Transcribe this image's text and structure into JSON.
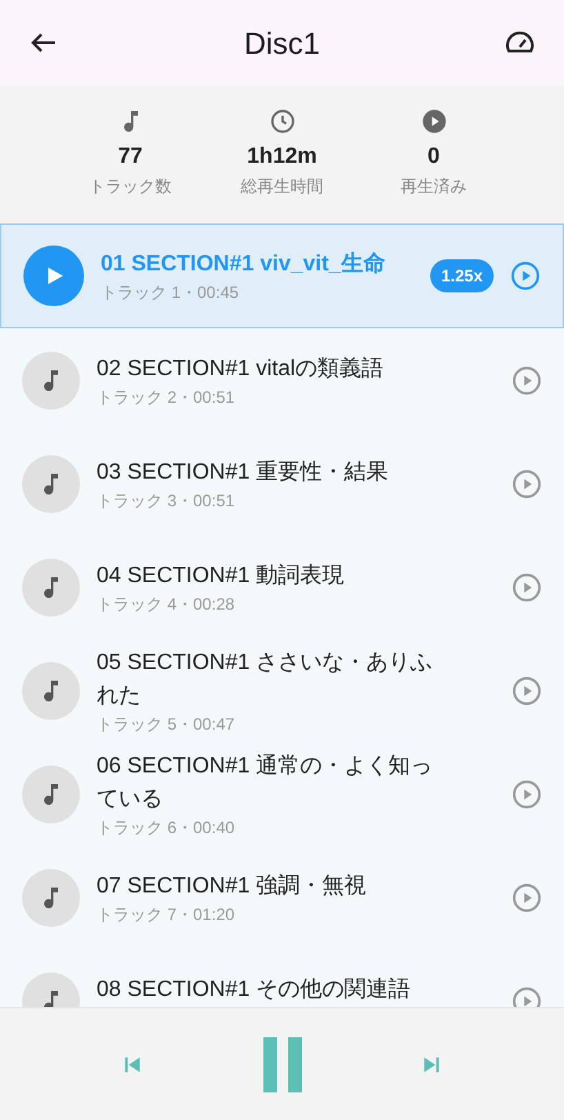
{
  "header": {
    "title": "Disc1"
  },
  "stats": [
    {
      "kind": "tracks",
      "value": "77",
      "label": "トラック数"
    },
    {
      "kind": "duration",
      "value": "1h12m",
      "label": "総再生時間"
    },
    {
      "kind": "played",
      "value": "0",
      "label": "再生済み"
    }
  ],
  "tracks": [
    {
      "title": "01 SECTION#1 viv_vit_生命",
      "subtitle": "トラック 1・00:45",
      "selected": true,
      "speed": "1.25x"
    },
    {
      "title": "02 SECTION#1 vitalの類義語",
      "subtitle": "トラック 2・00:51",
      "selected": false
    },
    {
      "title": "03 SECTION#1 重要性・結果",
      "subtitle": "トラック 3・00:51",
      "selected": false
    },
    {
      "title": "04 SECTION#1 動詞表現",
      "subtitle": "トラック 4・00:28",
      "selected": false
    },
    {
      "title": "05 SECTION#1 ささいな・ありふれた",
      "subtitle": "トラック 5・00:47",
      "selected": false
    },
    {
      "title": "06 SECTION#1 通常の・よく知っている",
      "subtitle": "トラック 6・00:40",
      "selected": false
    },
    {
      "title": "07 SECTION#1 強調・無視",
      "subtitle": "トラック 7・01:20",
      "selected": false
    },
    {
      "title": "08 SECTION#1 その他の関連語",
      "selected": false
    }
  ],
  "player": {
    "playing": true
  }
}
